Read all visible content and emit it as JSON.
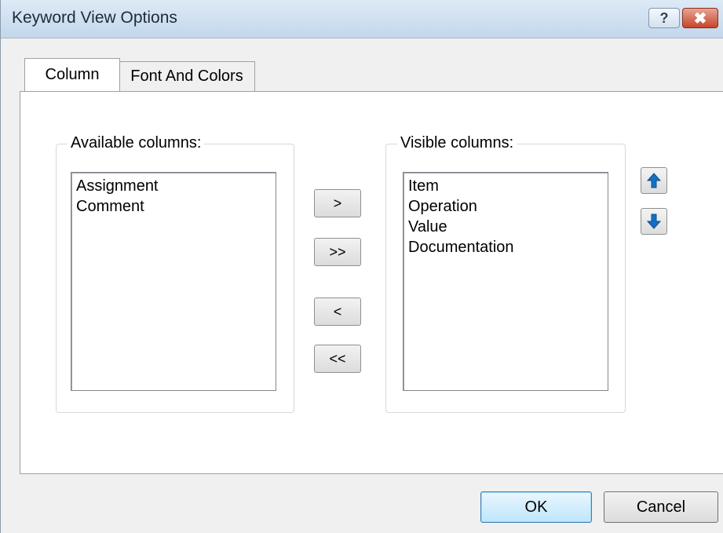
{
  "window": {
    "title": "Keyword View Options",
    "help_label": "?",
    "close_label": "✖"
  },
  "tabs": [
    {
      "label": "Column",
      "active": true
    },
    {
      "label": "Font And Colors",
      "active": false
    }
  ],
  "available": {
    "label": "Available columns:",
    "items": [
      "Assignment",
      "Comment"
    ]
  },
  "visible": {
    "label": "Visible columns:",
    "items": [
      "Item",
      "Operation",
      "Value",
      "Documentation"
    ]
  },
  "move_buttons": {
    "add": ">",
    "add_all": ">>",
    "remove": "<",
    "remove_all": "<<"
  },
  "order_buttons": {
    "up_icon": "up-arrow-icon",
    "down_icon": "down-arrow-icon"
  },
  "footer": {
    "ok": "OK",
    "cancel": "Cancel"
  },
  "colors": {
    "arrow_icon": "#1570c4",
    "ok_border": "#3c7fb1"
  }
}
